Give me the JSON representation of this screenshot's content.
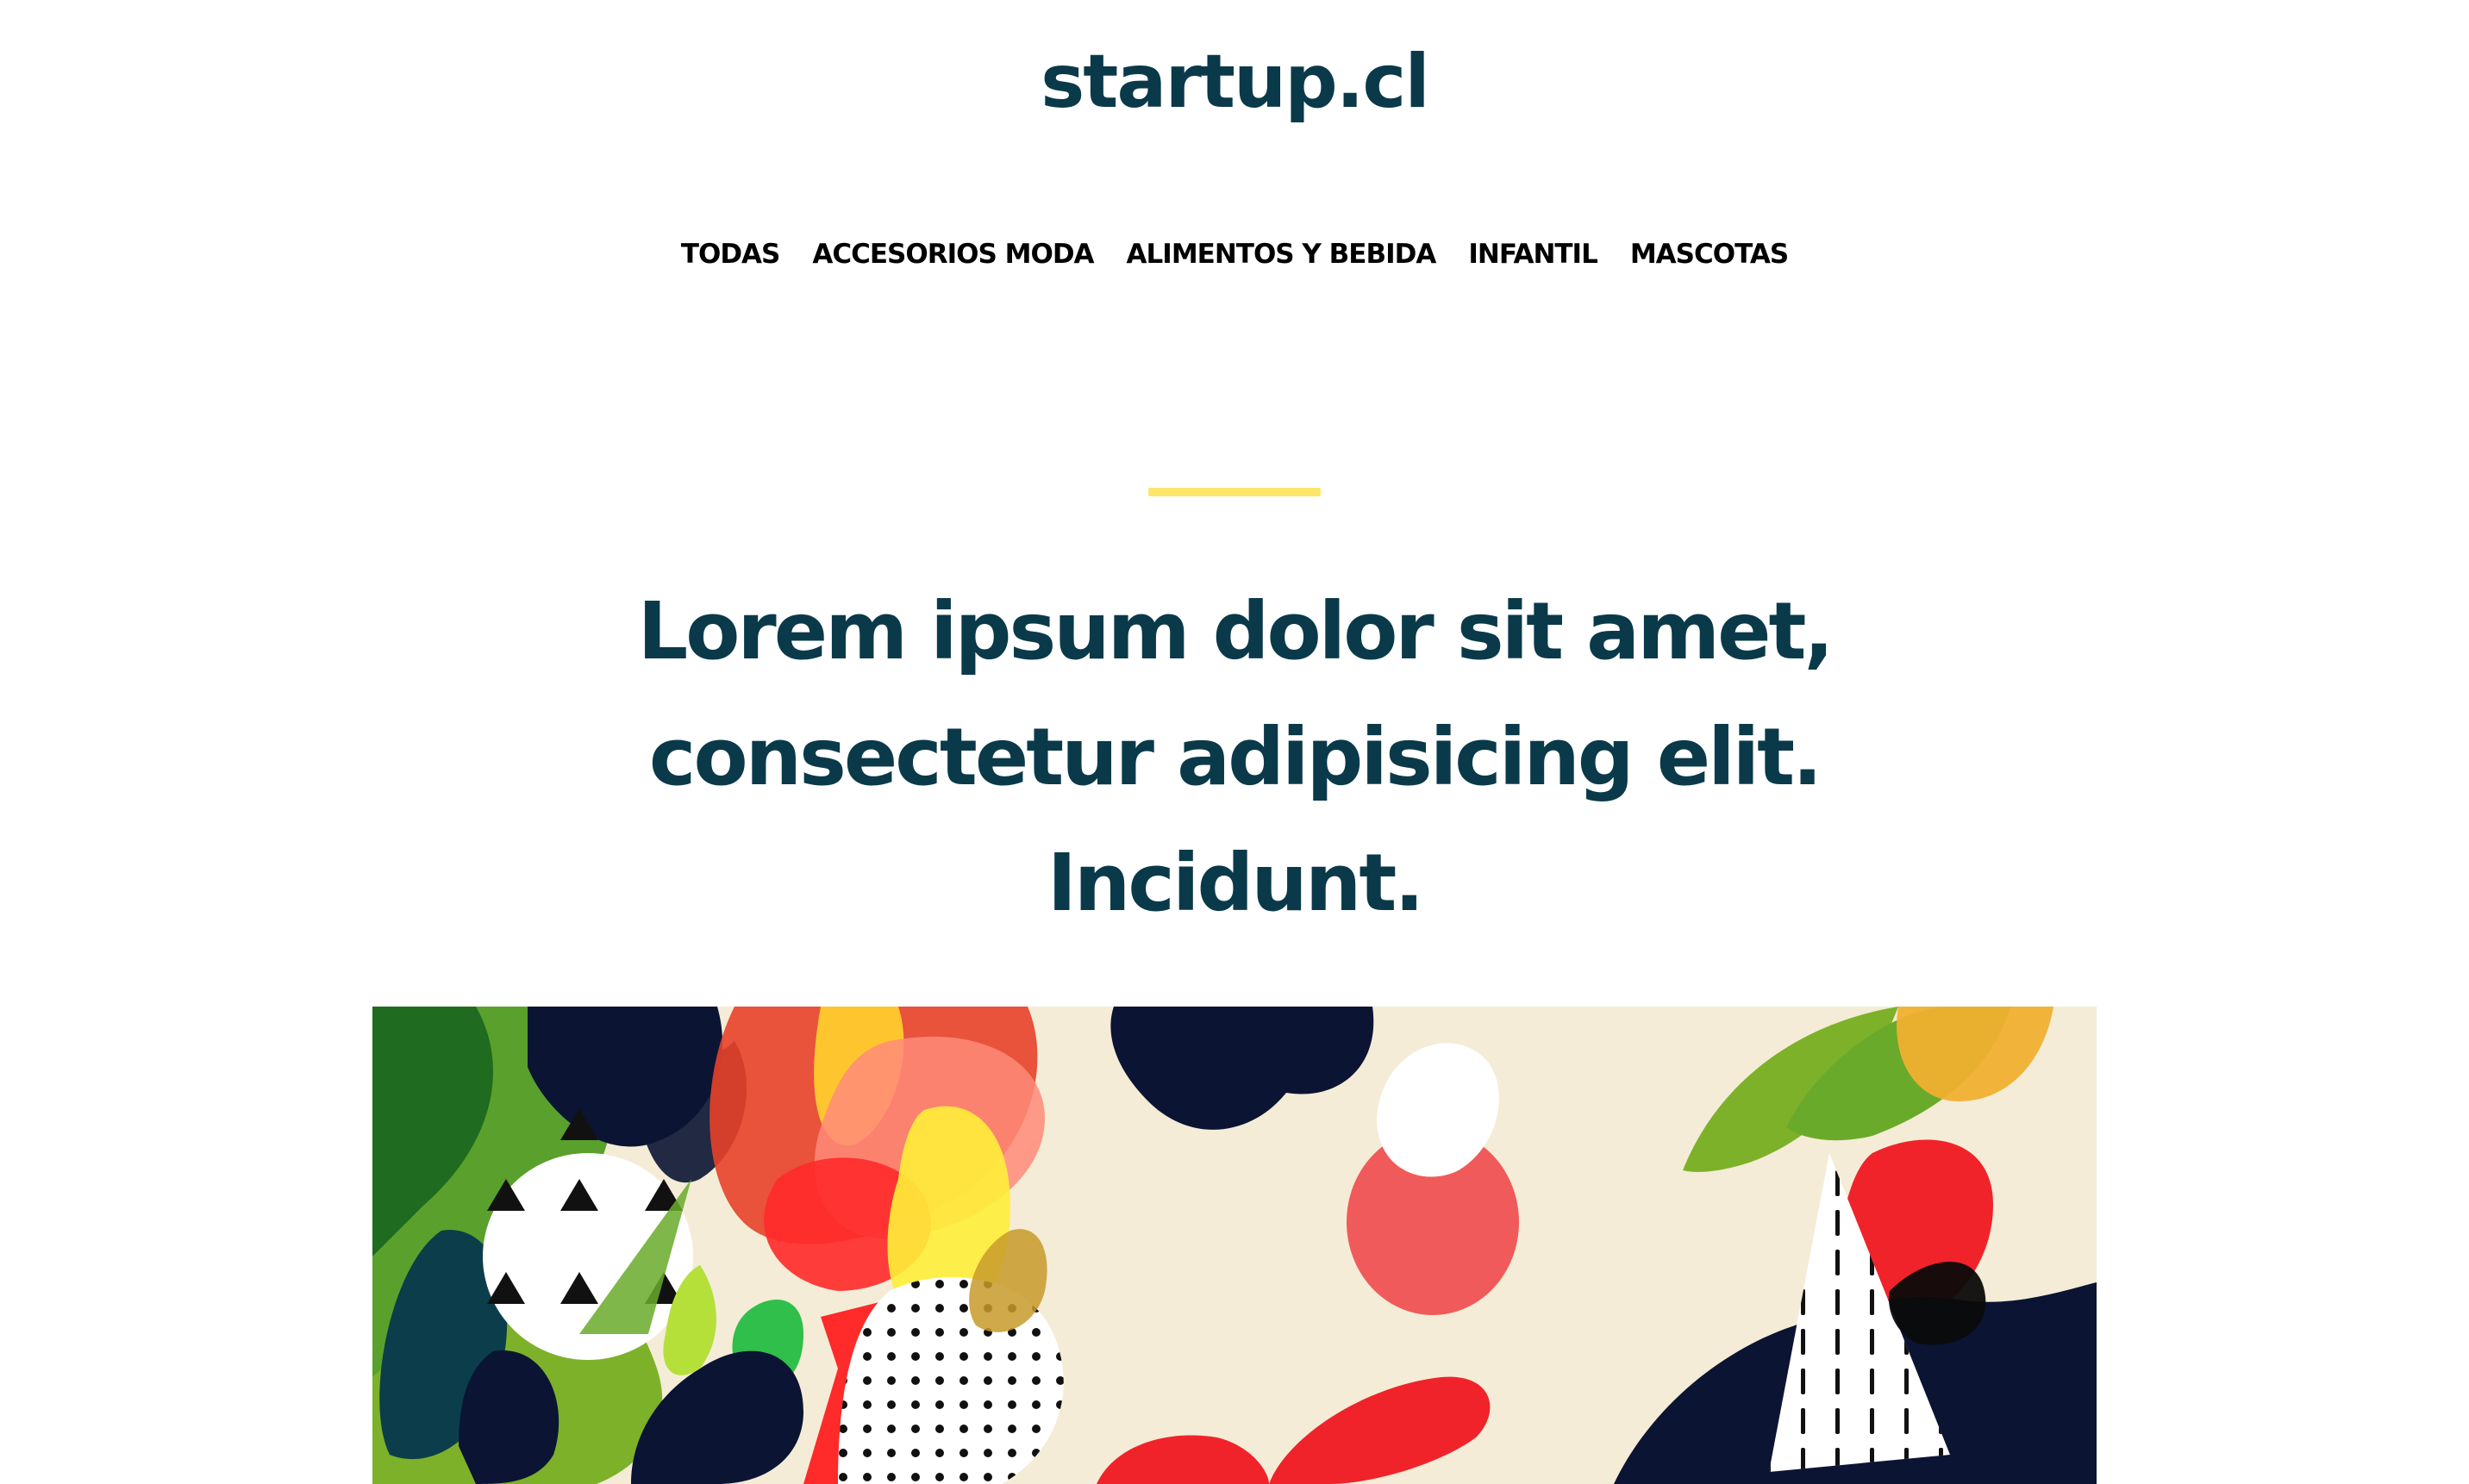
{
  "brand": {
    "logo_text": "startup.cl"
  },
  "nav": {
    "items": [
      {
        "label": "TODAS"
      },
      {
        "label": "ACCESORIOS MODA"
      },
      {
        "label": "ALIMENTOS Y BEBIDA"
      },
      {
        "label": "INFANTIL"
      },
      {
        "label": "MASCOTAS"
      }
    ]
  },
  "hero": {
    "accent_color": "#fde66a",
    "headline_color": "#0a3a4a",
    "headline": "Lorem ipsum dolor sit amet, consectetur adipisicing elit. Incidunt."
  }
}
